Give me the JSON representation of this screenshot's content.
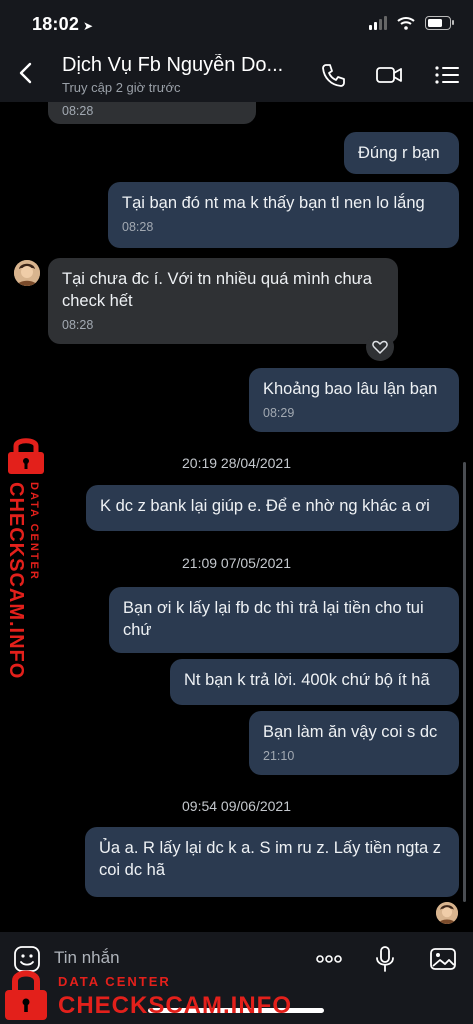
{
  "status_bar": {
    "time": "18:02",
    "location_icon": "location-arrow-icon"
  },
  "header": {
    "title": "Dịch Vụ Fb Nguyễn Do...",
    "subtitle": "Truy cập 2 giờ trước",
    "icons": [
      "back-icon",
      "phone-icon",
      "video-call-icon",
      "menu-icon"
    ]
  },
  "messages": [
    {
      "side": "received",
      "text": "",
      "time": "08:28"
    },
    {
      "side": "sent",
      "text": "Đúng r bạn",
      "time": ""
    },
    {
      "side": "sent",
      "text": "Tại bạn đó nt ma k thấy bạn tl nen lo lắng",
      "time": "08:28"
    },
    {
      "side": "received",
      "text": "Tại chưa đc í. Với tn nhiều quá mình chưa check hết",
      "time": "08:28"
    },
    {
      "side": "sent",
      "text": "Khoảng bao lâu lận bạn",
      "time": "08:29"
    },
    {
      "side": "sent",
      "text": "K dc z bank lại giúp e. Để e nhờ ng khác a ơi",
      "time": ""
    },
    {
      "side": "sent",
      "text": "Bạn ơi k lấy lại fb dc thì trả lại tiền cho tui chứ",
      "time": ""
    },
    {
      "side": "sent",
      "text": "Nt bạn k trả lời. 400k chứ bộ ít hã",
      "time": ""
    },
    {
      "side": "sent",
      "text": "Bạn làm ăn vậy coi s dc",
      "time": "21:10"
    },
    {
      "side": "sent",
      "text": "Ủa a. R lấy lại dc k a. S im ru z. Lấy tiền ngta z coi dc hã",
      "time": ""
    }
  ],
  "date_separators": [
    "20:19 28/04/2021",
    "21:09 07/05/2021",
    "09:54 09/06/2021"
  ],
  "composer": {
    "placeholder": "Tin nhắn",
    "icons": [
      "sticker-icon",
      "more-icon",
      "microphone-icon",
      "image-icon"
    ]
  },
  "watermark": {
    "line1": "DATA CENTER",
    "line2": "CHECKSCAM.INFO",
    "color": "#e3201b"
  },
  "colors": {
    "bar_bg": "#16181d",
    "received_bubble": "#2f3134",
    "sent_bubble": "#2b3a50"
  }
}
